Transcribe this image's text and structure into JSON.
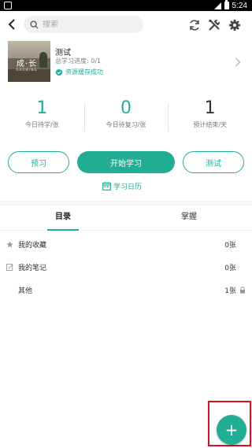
{
  "status_bar": {
    "time": "5:24"
  },
  "topbar": {
    "search_placeholder": "搜索",
    "icons": [
      "back-arrow-icon",
      "sync-icon",
      "tools-icon",
      "gear-icon"
    ]
  },
  "deck": {
    "cover_title": "成·长",
    "cover_subtitle": "GROWING",
    "name": "测试",
    "progress": "总学习进度: 0/1",
    "status": "资源缓存成功"
  },
  "stats": [
    {
      "value": "1",
      "label": "今日待学/张"
    },
    {
      "value": "0",
      "label": "今日待复习/张"
    },
    {
      "value": "1",
      "label": "预计结束/天"
    }
  ],
  "buttons": {
    "preview": "预习",
    "start": "开始学习",
    "test": "测试",
    "calendar": "学习日历"
  },
  "tabs": [
    {
      "label": "目录",
      "active": true
    },
    {
      "label": "掌握",
      "active": false
    }
  ],
  "list": [
    {
      "label": "我的收藏",
      "count": "0张",
      "icon": "star-icon"
    },
    {
      "label": "我的笔记",
      "count": "0张",
      "icon": "note-icon"
    },
    {
      "label": "其他",
      "count": "1张",
      "icon": "lock-icon"
    }
  ],
  "fab": {
    "label": "+"
  },
  "colors": {
    "accent": "#21ae95",
    "highlight": "#d6111e"
  }
}
